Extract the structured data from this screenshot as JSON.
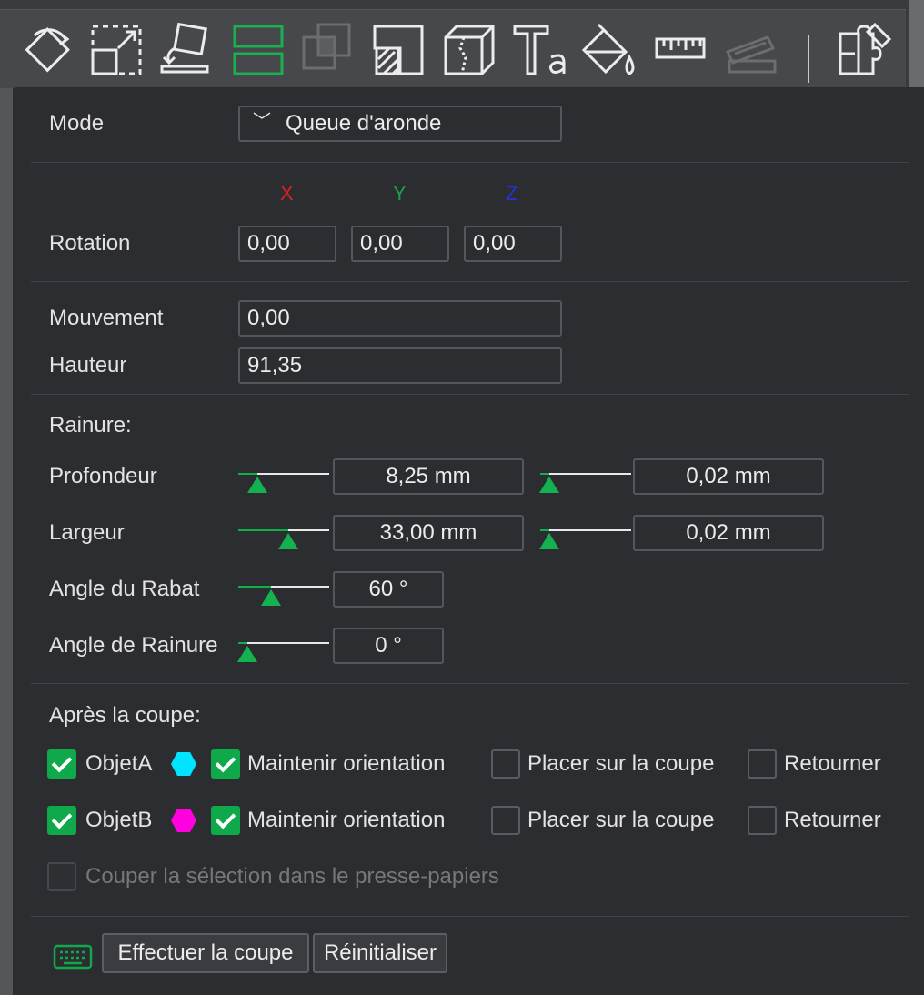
{
  "toolbar": {
    "icons": [
      "rotate-icon",
      "scale-icon",
      "lay-on-face-icon",
      "cut-icon",
      "mesh-boolean-icon",
      "support-painting-icon",
      "seam-painting-icon",
      "text-icon",
      "color-painting-icon",
      "measure-icon",
      "assembly-icon",
      "variable-layer-height-icon"
    ]
  },
  "mode": {
    "label": "Mode",
    "value": "Queue d'aronde"
  },
  "axes": {
    "x": "X",
    "y": "Y",
    "z": "Z",
    "x_color": "#e02020",
    "y_color": "#17a34a",
    "z_color": "#2233dd"
  },
  "rotation": {
    "label": "Rotation",
    "x": "0,00",
    "y": "0,00",
    "z": "0,00"
  },
  "movement": {
    "label": "Mouvement",
    "value": "0,00"
  },
  "height": {
    "label": "Hauteur",
    "value": "91,35"
  },
  "groove": {
    "title": "Rainure:",
    "depth": {
      "label": "Profondeur",
      "value": "8,25  mm",
      "tolerance": "0,02  mm",
      "slider": 0.21,
      "tol_slider": 0.1
    },
    "width": {
      "label": "Largeur",
      "value": "33,00  mm",
      "tolerance": "0,02  mm",
      "slider": 0.55,
      "tol_slider": 0.1
    },
    "flap_angle": {
      "label": "Angle du Rabat",
      "value": "60 °",
      "slider": 0.36
    },
    "groove_angle": {
      "label": "Angle de Rainure",
      "value": "0 °",
      "slider": 0.1
    }
  },
  "after_cut": {
    "title": "Après la coupe:",
    "objects": [
      {
        "name": "ObjetA",
        "checked": true,
        "color": "#00e5ff",
        "keep_orientation": {
          "label": "Maintenir orientation",
          "checked": true
        },
        "place_on_cut": {
          "label": "Placer sur la coupe",
          "checked": false
        },
        "flip": {
          "label": "Retourner",
          "checked": false
        }
      },
      {
        "name": "ObjetB",
        "checked": true,
        "color": "#ff00e0",
        "keep_orientation": {
          "label": "Maintenir orientation",
          "checked": true
        },
        "place_on_cut": {
          "label": "Placer sur la coupe",
          "checked": false
        },
        "flip": {
          "label": "Retourner",
          "checked": false
        }
      }
    ],
    "clipboard": {
      "label": "Couper la sélection dans le presse-papiers",
      "enabled": false
    }
  },
  "actions": {
    "perform": "Effectuer la coupe",
    "reset": "Réinitialiser"
  },
  "colors": {
    "accent": "#0fa84a",
    "panel": "#2c2d31",
    "toolbar": "#46484b"
  }
}
